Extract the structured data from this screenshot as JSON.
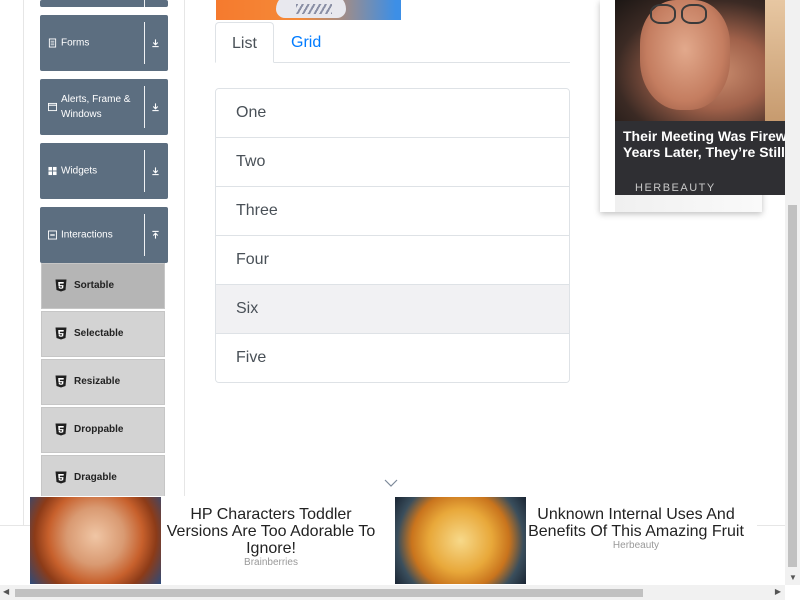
{
  "sidebar": {
    "groups": [
      {
        "label": "Forms",
        "icon": "form-icon",
        "toggle": "download-icon"
      },
      {
        "label": "Alerts, Frame & Windows",
        "icon": "window-icon",
        "toggle": "download-icon"
      },
      {
        "label": "Widgets",
        "icon": "widgets-icon",
        "toggle": "download-icon"
      },
      {
        "label": "Interactions",
        "icon": "interactions-icon",
        "toggle": "upload-icon"
      }
    ],
    "interaction_items": [
      {
        "label": "Sortable",
        "active": true
      },
      {
        "label": "Selectable",
        "active": false
      },
      {
        "label": "Resizable",
        "active": false
      },
      {
        "label": "Droppable",
        "active": false
      },
      {
        "label": "Dragable",
        "active": false
      }
    ]
  },
  "tabs": {
    "list_label": "List",
    "grid_label": "Grid",
    "active": "List"
  },
  "sortable_list": [
    "One",
    "Two",
    "Three",
    "Four",
    "Six",
    "Five"
  ],
  "right_ad": {
    "title": "Their Meeting Was Firew Years Later, They're Still",
    "title_line1": "Their Meeting Was Firew",
    "title_line2": "Years Later, They’re Still",
    "brand": "HERBEAUTY"
  },
  "bottom_ads": [
    {
      "title": "HP Characters Toddler Versions Are Too Adorable To Ignore!",
      "source": "Brainberries"
    },
    {
      "title": "Unknown Internal Uses And Benefits Of This Amazing Fruit",
      "source": "Herbeauty"
    }
  ],
  "colors": {
    "menu_group_bg": "#5c6e80",
    "sub_item_bg": "#d3d3d3",
    "sub_item_active_bg": "#b5b5b5",
    "tab_link": "#007bff",
    "list_hover_bg": "#f1f1f3"
  }
}
